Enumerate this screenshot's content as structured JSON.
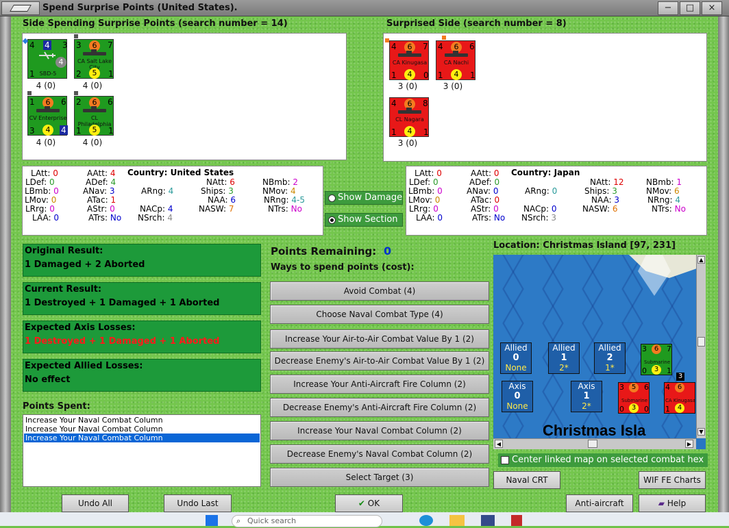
{
  "window": {
    "title": "Spend Surprise Points (United States).",
    "controls": [
      "−",
      "□",
      "×"
    ]
  },
  "spending_side": {
    "label": "Side Spending Surprise Points (search number = 14)",
    "units": [
      {
        "name": "SBD-5",
        "tl": "4",
        "tm": "4",
        "tr": "3",
        "bl": "1",
        "bm": "4",
        "br": "",
        "sub": "4 (0)",
        "kind": "plane"
      },
      {
        "name": "CA Salt Lake City",
        "tl": "3",
        "tm": "6",
        "tr": "7",
        "bl": "2",
        "bm": "5",
        "br": "1",
        "sub": "4 (0)",
        "kind": "ship"
      },
      {
        "name": "CV Enterprise",
        "tl": "1",
        "tm": "6",
        "tr": "6",
        "bl": "3",
        "bm": "4",
        "br": "4",
        "sub": "4 (0)",
        "kind": "ship"
      },
      {
        "name": "CL Philadelphia",
        "tl": "2",
        "tm": "6",
        "tr": "6",
        "bl": "1",
        "bm": "5",
        "br": "1",
        "sub": "4 (0)",
        "kind": "ship"
      }
    ]
  },
  "surprised_side": {
    "label": "Surprised Side (search number = 8)",
    "units": [
      {
        "name": "CA Kinugasa",
        "tl": "4",
        "tm": "6",
        "tr": "7",
        "bl": "1",
        "bm": "4",
        "br": "0",
        "sub": "3 (0)"
      },
      {
        "name": "CA Nachi",
        "tl": "4",
        "tm": "6",
        "tr": "6",
        "bl": "1",
        "bm": "4",
        "br": "1",
        "sub": "3 (0)"
      },
      {
        "name": "CL Nagara",
        "tl": "4",
        "tm": "6",
        "tr": "8",
        "bl": "1",
        "bm": "4",
        "br": "1",
        "sub": "3 (0)"
      }
    ]
  },
  "stats_us": {
    "country_label": "Country: United States",
    "LAtt": "0",
    "AAtt": "4",
    "NAtt": "6",
    "NBmb": "2",
    "LDef": "0",
    "ADef": "4",
    "Ships": "3",
    "NMov": "4",
    "LBmb": "0",
    "ANav": "3",
    "ARng": "4",
    "NAA": "6",
    "NRng": "4-5",
    "LMov": "0",
    "ATac": "1",
    "NACp": "4",
    "NASW": "7",
    "NTrs": "No",
    "LRrg": "0",
    "AStr": "0",
    "NSrch": "4",
    "LAA": "0",
    "ATrs": "No"
  },
  "stats_jp": {
    "country_label": "Country: Japan",
    "LAtt": "0",
    "AAtt": "0",
    "NAtt": "12",
    "NBmb": "1",
    "LDef": "0",
    "ADef": "0",
    "Ships": "3",
    "NMov": "6",
    "LBmb": "0",
    "ANav": "0",
    "ARng": "0",
    "NAA": "3",
    "NRng": "4",
    "LMov": "0",
    "ATac": "0",
    "NACp": "0",
    "NASW": "6",
    "NTrs": "No",
    "LRrg": "0",
    "AStr": "0",
    "NSrch": "3",
    "LAA": "0",
    "ATrs": "No"
  },
  "toggles": {
    "show_damage": "Show Damage",
    "show_section": "Show Section",
    "selected": "Show Section"
  },
  "results": {
    "original_label": "Original Result:",
    "original_value": "1 Damaged + 2 Aborted",
    "current_label": "Current Result:",
    "current_value": "1 Destroyed + 1 Damaged + 1 Aborted",
    "axis_label": "Expected Axis Losses:",
    "axis_value": "1 Destroyed + 1 Damaged + 1 Aborted",
    "allied_label": "Expected Allied Losses:",
    "allied_value": "No effect"
  },
  "points": {
    "remaining_label": "Points Remaining:",
    "remaining_value": "0",
    "ways_label": "Ways to spend points (cost):",
    "spent_label": "Points Spent:",
    "spent_items": [
      "Increase Your Naval Combat Column",
      "Increase Your Naval Combat Column",
      "Increase Your Naval Combat Column"
    ],
    "selected_index": 2
  },
  "spend_buttons": [
    "Avoid Combat (4)",
    "Choose Naval Combat Type (4)",
    "Increase Your Air-to-Air Combat Value By 1 (2)",
    "Decrease Enemy's Air-to-Air Combat Value By 1 (2)",
    "Increase Your Anti-Aircraft Fire Column (2)",
    "Decrease Enemy's Anti-Aircraft Fire Column (2)",
    "Increase Your Naval Combat Column (2)",
    "Decrease Enemy's Naval Combat Column (2)",
    "Select Target (3)"
  ],
  "map": {
    "location_label": "Location: Christmas Island [97, 231]",
    "place_name": "Christmas Isla",
    "allied_boxes": [
      {
        "title": "Allied",
        "num": "0",
        "sub": "None"
      },
      {
        "title": "Allied",
        "num": "1",
        "sub": "2*"
      },
      {
        "title": "Allied",
        "num": "2",
        "sub": "1*"
      }
    ],
    "axis_boxes": [
      {
        "title": "Axis",
        "num": "0",
        "sub": "None"
      },
      {
        "title": "Axis",
        "num": "1",
        "sub": "2*"
      }
    ],
    "mini_units": [
      {
        "name": "Submarine",
        "tl": "3",
        "tm": "6",
        "tr": "7",
        "bl": "0",
        "bm": "3",
        "br": "1",
        "side": "allied"
      },
      {
        "name": "Submarine",
        "tl": "3",
        "tm": "5",
        "tr": "6",
        "bl": "0",
        "bm": "3",
        "br": "0",
        "side": "axis"
      },
      {
        "name": "CA Kinugasa",
        "tl": "4",
        "tm": "6",
        "tr": "7",
        "bl": "1",
        "bm": "4",
        "br": "0",
        "side": "axis"
      }
    ],
    "stack_count": "3",
    "center_checkbox": "Center linked map on selected combat hex"
  },
  "bottom_buttons": {
    "undo_all": "Undo All",
    "undo_last": "Undo Last",
    "ok": "OK",
    "naval_crt": "Naval CRT",
    "wif_fe_charts": "WIF FE Charts",
    "anti_aircraft_crt": "Anti-aircraft CRT",
    "help": "Help"
  },
  "taskbar": {
    "search_placeholder": "Quick search"
  },
  "colors": {
    "felt": "#74c64d",
    "result_box": "#1d9a3a",
    "allied_counter": "#1f9a1f",
    "axis_counter": "#e81818",
    "map_sea": "#2d7ac6",
    "selected_row": "#0a66d6"
  }
}
